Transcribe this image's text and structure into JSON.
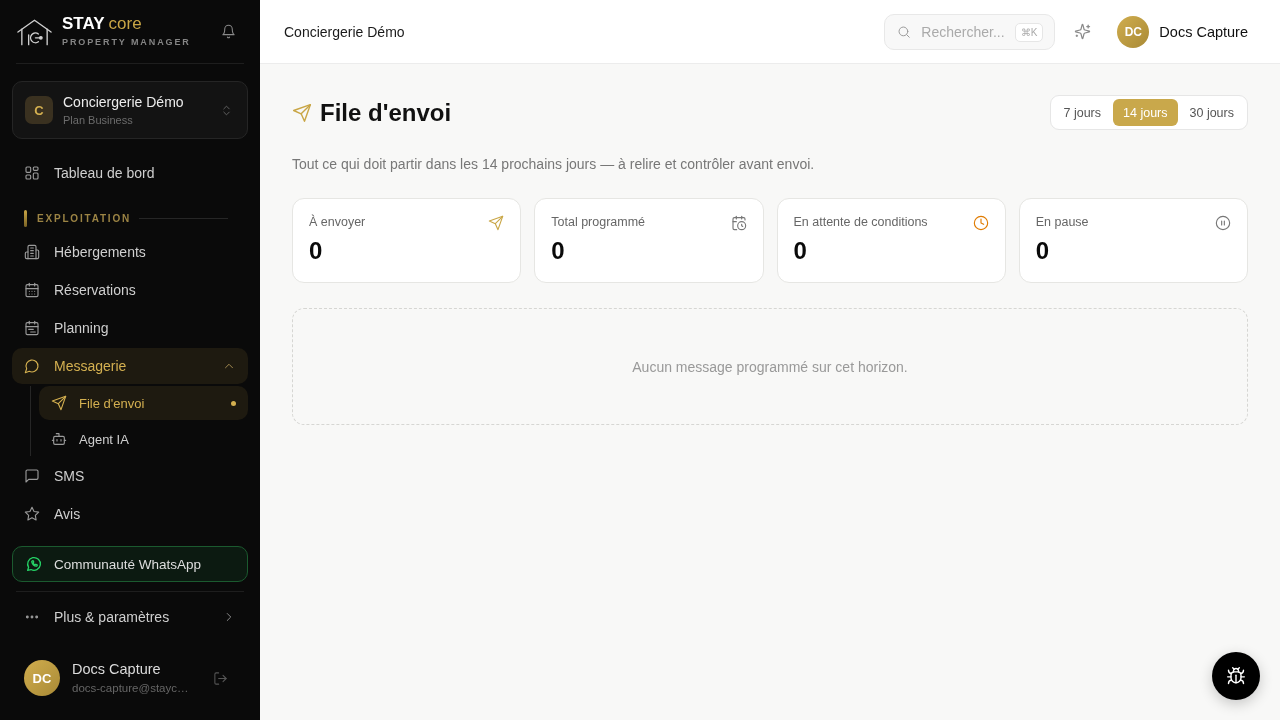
{
  "sidebar": {
    "brand": {
      "name": "STAY",
      "accent": "core",
      "tagline": "PROPERTY MANAGER"
    },
    "workspace": {
      "initial": "C",
      "name": "Conciergerie Démo",
      "plan": "Plan Business"
    },
    "nav": [
      {
        "kind": "link",
        "label": "Tableau de bord",
        "selected": false
      },
      {
        "kind": "section",
        "label": "EXPLOITATION"
      },
      {
        "kind": "link",
        "label": "Hébergements",
        "selected": false
      },
      {
        "kind": "link",
        "label": "Réservations",
        "selected": false
      },
      {
        "kind": "link",
        "label": "Planning",
        "selected": false
      },
      {
        "kind": "group",
        "label": "Messagerie",
        "selected": true,
        "expanded": true,
        "children": [
          {
            "label": "File d'envoi",
            "selected": true
          },
          {
            "label": "Agent IA",
            "selected": false
          }
        ]
      },
      {
        "kind": "link",
        "label": "SMS",
        "selected": false
      },
      {
        "kind": "link",
        "label": "Avis",
        "selected": false
      }
    ],
    "community": {
      "label": "Communauté WhatsApp"
    },
    "more": {
      "label": "Plus & paramètres"
    },
    "user": {
      "initials": "DC",
      "name": "Docs Capture",
      "email": "docs-capture@stayc…"
    }
  },
  "header": {
    "breadcrumb": "Conciergerie Démo",
    "search": {
      "placeholder": "Rechercher...",
      "shortcut": "⌘K"
    },
    "user": {
      "initials": "DC",
      "name": "Docs Capture"
    }
  },
  "page": {
    "title": "File d'envoi",
    "ranges": [
      {
        "label": "7 jours",
        "selected": false
      },
      {
        "label": "14 jours",
        "selected": true
      },
      {
        "label": "30 jours",
        "selected": false
      }
    ],
    "subtitle": "Tout ce qui doit partir dans les 14 prochains jours — à relire et contrôler avant envoi.",
    "stats": [
      {
        "label": "À envoyer",
        "value": "0"
      },
      {
        "label": "Total programmé",
        "value": "0"
      },
      {
        "label": "En attente de conditions",
        "value": "0"
      },
      {
        "label": "En pause",
        "value": "0"
      }
    ],
    "empty_message": "Aucun message programmé sur cet horizon."
  }
}
